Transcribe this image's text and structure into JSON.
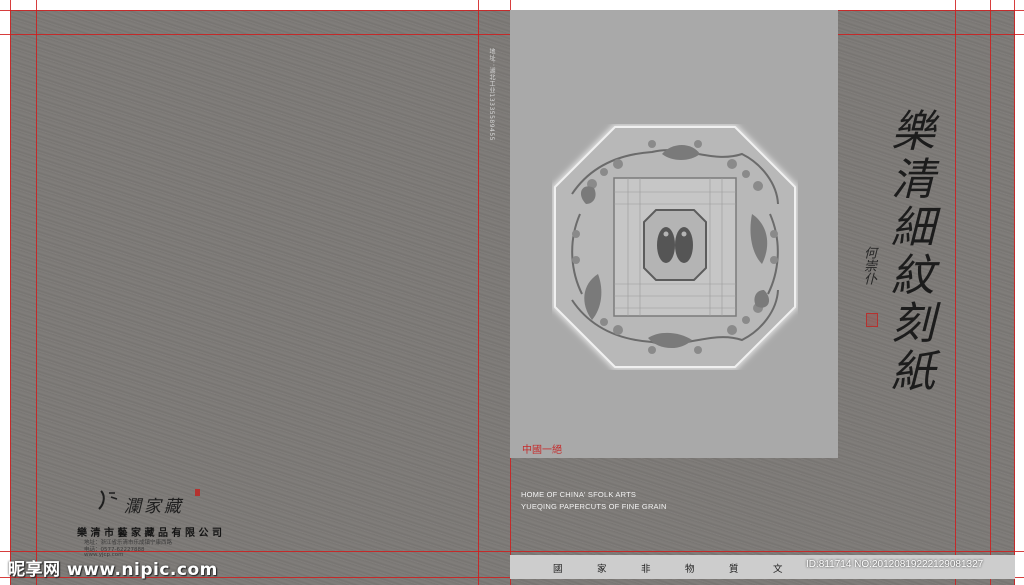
{
  "spine": {
    "text": "地址：湖北工业13335589455"
  },
  "front": {
    "title": "樂清細紋刻紙",
    "subtitle": "何崇仆",
    "panel_caption": "中國一絕",
    "english_line1": "HOME OF CHINA' SFOLK ARTS",
    "english_line2": "YUEQING PAPERCUTS OF FINE GRAIN"
  },
  "back": {
    "logo_text": "瀾家藏",
    "company": "樂清市藝家藏品有限公司",
    "address_line": "地址：浙江省乐清市乐成镇宁康西路",
    "phone_line": "电话：0577-62227888",
    "web_line": "www.yjcp.com"
  },
  "bottom_bar": {
    "chars": [
      "國",
      "家",
      "非",
      "物",
      "質",
      "文"
    ]
  },
  "watermark": {
    "left": "昵享网 www.nipic.com",
    "right": "ID:811714 NO:20120819222129081327"
  },
  "colors": {
    "board": "#7d7a77",
    "panel": "#a9a9a9",
    "guide": "#d01c1c",
    "ornament_fill": "#bdbdbd",
    "seal": "#b5322f"
  },
  "icons": {
    "ornament": "papercut-octagon-fish-medallion",
    "seal": "red-seal-stamp"
  }
}
